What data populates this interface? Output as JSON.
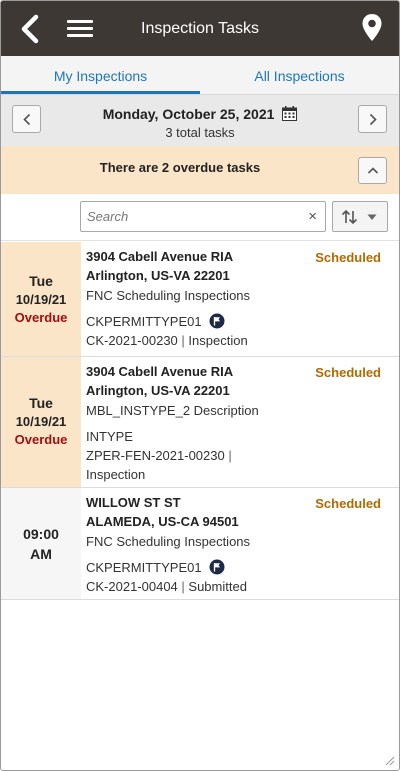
{
  "header": {
    "title": "Inspection Tasks",
    "back_icon": "back-chevron-icon",
    "menu_icon": "hamburger-menu-icon",
    "location_icon": "map-pin-icon"
  },
  "tabs": [
    {
      "label": "My Inspections",
      "active": true
    },
    {
      "label": "All Inspections",
      "active": false
    }
  ],
  "date_nav": {
    "date": "Monday, October 25, 2021",
    "total": "3 total tasks",
    "calendar_icon": "calendar-icon"
  },
  "overdue_banner": {
    "text": "There are 2 overdue tasks"
  },
  "search": {
    "placeholder": "Search",
    "value": "",
    "clear_symbol": "×"
  },
  "tasks": [
    {
      "day": "Tue",
      "date": "10/19/21",
      "due_status": "Overdue",
      "address_line1": "3904 Cabell Avenue RIA",
      "address_line2": "Arlington, US-VA 22201",
      "description": "FNC Scheduling Inspections",
      "permit_type": "CKPERMITTYPE01",
      "record_id": "CK-2021-00230",
      "separator": " | ",
      "record_type": "Inspection",
      "status": "Scheduled"
    },
    {
      "day": "Tue",
      "date": "10/19/21",
      "due_status": "Overdue",
      "address_line1": "3904 Cabell Avenue RIA",
      "address_line2": "Arlington, US-VA 22201",
      "description": "MBL_INSTYPE_2 Description",
      "permit_type": "INTYPE",
      "record_id": "ZPER-FEN-2021-00230",
      "separator": " | ",
      "record_type": "Inspection",
      "status": "Scheduled"
    },
    {
      "time_line1": "09:00",
      "time_line2": "AM",
      "address_line1": "WILLOW ST ST",
      "address_line2": "ALAMEDA, US-CA 94501",
      "description": "FNC Scheduling Inspections",
      "permit_type": "CKPERMITTYPE01",
      "record_id": "CK-2021-00404",
      "separator": " | ",
      "record_type": "Submitted",
      "status": "Scheduled"
    }
  ],
  "colors": {
    "header_bg": "#3d3834",
    "accent": "#1e77b5",
    "overdue_bg": "#fbe5c8",
    "overdue_text": "#a10f0f",
    "scheduled": "#b16a00"
  }
}
